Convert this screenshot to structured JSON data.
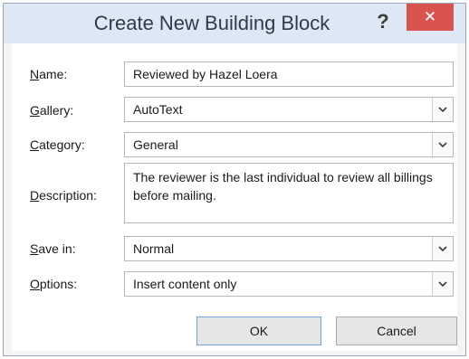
{
  "dialog": {
    "title": "Create New Building Block",
    "help_label": "?",
    "close_label": "✕"
  },
  "form": {
    "name": {
      "label_key": "N",
      "label_rest": "ame:",
      "value": "Reviewed by Hazel Loera"
    },
    "gallery": {
      "label_key": "G",
      "label_rest": "allery:",
      "value": "AutoText"
    },
    "category": {
      "label_key": "C",
      "label_rest": "ategory:",
      "value": "General"
    },
    "description": {
      "label_key": "D",
      "label_rest": "escription:",
      "value": "The reviewer is the last individual to review all billings before mailing."
    },
    "save_in": {
      "label_key": "S",
      "label_rest": "ave in:",
      "value": "Normal"
    },
    "options": {
      "label_key": "O",
      "label_rest": "ptions:",
      "value": "Insert content only"
    }
  },
  "buttons": {
    "ok": "OK",
    "cancel": "Cancel"
  },
  "icons": {
    "dropdown": "chevron-down-icon",
    "close": "close-icon",
    "help": "help-icon"
  },
  "colors": {
    "titlebar": "#dde8f4",
    "close_button": "#d9534f",
    "ok_border": "#6aa4d8"
  }
}
